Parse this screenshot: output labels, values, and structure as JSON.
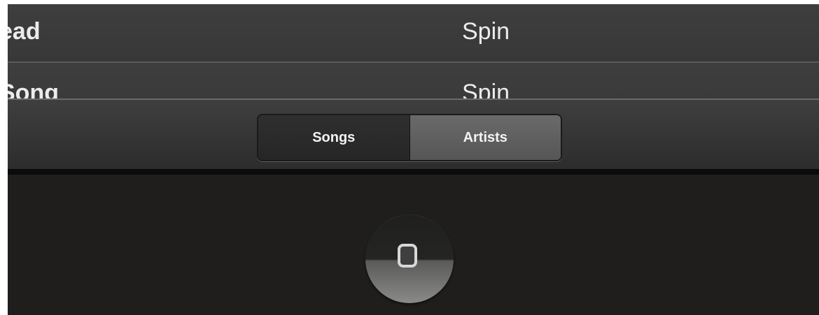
{
  "song_list": {
    "rows": [
      {
        "song": "ead",
        "artist": "Spin"
      },
      {
        "song": "Song",
        "artist": "Spin"
      }
    ]
  },
  "toolbar": {
    "segments": [
      {
        "label": "Songs",
        "selected": false
      },
      {
        "label": "Artists",
        "selected": true
      }
    ]
  },
  "device": {
    "home_button_icon": "rounded-square-icon"
  }
}
